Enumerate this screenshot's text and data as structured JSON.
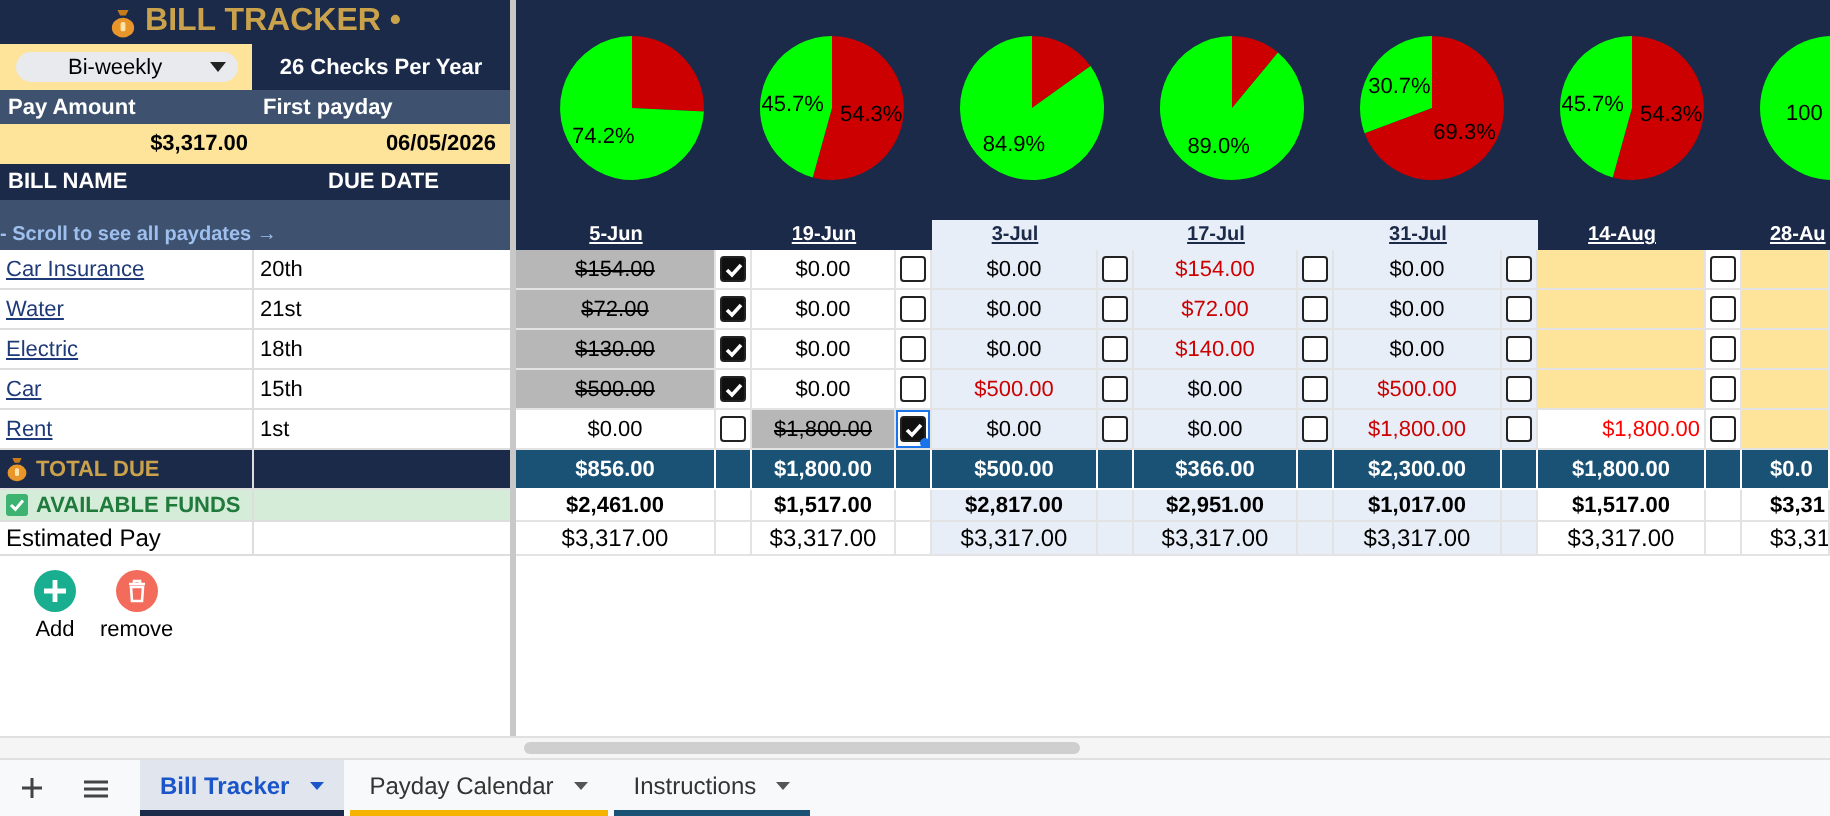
{
  "header": {
    "title": "BILL TRACKER •",
    "frequency": "Bi-weekly",
    "checks_per_year": "26 Checks Per Year",
    "pay_amount_label": "Pay Amount",
    "first_payday_label": "First payday",
    "pay_amount": "$3,317.00",
    "first_payday": "06/05/2026"
  },
  "bills_header": {
    "name": "BILL NAME",
    "due": "DUE DATE",
    "scroll_hint": "- Scroll to see all paydates →"
  },
  "bills": [
    {
      "name": "Car Insurance",
      "due": "20th"
    },
    {
      "name": "Water",
      "due": "21st"
    },
    {
      "name": "Electric",
      "due": "18th"
    },
    {
      "name": "Car",
      "due": "15th"
    },
    {
      "name": "Rent",
      "due": "1st"
    }
  ],
  "summary": {
    "total_due": "TOTAL DUE",
    "available_funds": "AVAILABLE FUNDS",
    "estimated_pay": "Estimated Pay"
  },
  "actions": [
    {
      "kind": "add",
      "label": "Add"
    },
    {
      "kind": "remove",
      "label": "remove"
    }
  ],
  "pies": [
    {
      "chart_data": {
        "type": "pie",
        "values": [
          25.8,
          74.2
        ],
        "value_labels": [
          null,
          "74.2%"
        ]
      }
    },
    {
      "chart_data": {
        "type": "pie",
        "values": [
          54.3,
          45.7
        ],
        "value_labels": [
          "54.3%",
          "45.7%"
        ]
      }
    },
    {
      "chart_data": {
        "type": "pie",
        "values": [
          15.1,
          84.9
        ],
        "value_labels": [
          null,
          "84.9%"
        ]
      }
    },
    {
      "chart_data": {
        "type": "pie",
        "values": [
          11.0,
          89.0
        ],
        "value_labels": [
          null,
          "89.0%"
        ]
      }
    },
    {
      "chart_data": {
        "type": "pie",
        "values": [
          69.3,
          30.7
        ],
        "value_labels": [
          "69.3%",
          "30.7%"
        ]
      }
    },
    {
      "chart_data": {
        "type": "pie",
        "values": [
          54.3,
          45.7
        ],
        "value_labels": [
          "54.3%",
          "45.7%"
        ]
      }
    },
    {
      "chart_data": {
        "type": "pie",
        "values": [
          0,
          100
        ],
        "value_labels": [
          null,
          "100"
        ]
      }
    }
  ],
  "periods": [
    {
      "date": "5-Jun",
      "highlighted": false,
      "total": "$856.00",
      "funds": "$2,461.00",
      "estimated": "$3,317.00",
      "cells": [
        {
          "amount": "$154.00",
          "kind": "paid",
          "checked": true,
          "selected": false
        },
        {
          "amount": "$72.00",
          "kind": "paid",
          "checked": true,
          "selected": false
        },
        {
          "amount": "$130.00",
          "kind": "paid",
          "checked": true,
          "selected": false
        },
        {
          "amount": "$500.00",
          "kind": "paid",
          "checked": true,
          "selected": false
        },
        {
          "amount": "$0.00",
          "kind": "none",
          "checked": false,
          "selected": false
        }
      ]
    },
    {
      "date": "19-Jun",
      "highlighted": false,
      "total": "$1,800.00",
      "funds": "$1,517.00",
      "estimated": "$3,317.00",
      "cells": [
        {
          "amount": "$0.00",
          "kind": "none",
          "checked": false,
          "selected": false
        },
        {
          "amount": "$0.00",
          "kind": "none",
          "checked": false,
          "selected": false
        },
        {
          "amount": "$0.00",
          "kind": "none",
          "checked": false,
          "selected": false
        },
        {
          "amount": "$0.00",
          "kind": "none",
          "checked": false,
          "selected": false
        },
        {
          "amount": "$1,800.00",
          "kind": "paid",
          "checked": true,
          "selected": true
        }
      ]
    },
    {
      "date": "3-Jul",
      "highlighted": true,
      "total": "$500.00",
      "funds": "$2,817.00",
      "estimated": "$3,317.00",
      "cells": [
        {
          "amount": "$0.00",
          "kind": "none",
          "checked": false,
          "selected": false
        },
        {
          "amount": "$0.00",
          "kind": "none",
          "checked": false,
          "selected": false
        },
        {
          "amount": "$0.00",
          "kind": "none",
          "checked": false,
          "selected": false
        },
        {
          "amount": "$500.00",
          "kind": "due",
          "checked": false,
          "selected": false
        },
        {
          "amount": "$0.00",
          "kind": "none",
          "checked": false,
          "selected": false
        }
      ]
    },
    {
      "date": "17-Jul",
      "highlighted": true,
      "total": "$366.00",
      "funds": "$2,951.00",
      "estimated": "$3,317.00",
      "cells": [
        {
          "amount": "$154.00",
          "kind": "due",
          "checked": false,
          "selected": false
        },
        {
          "amount": "$72.00",
          "kind": "due",
          "checked": false,
          "selected": false
        },
        {
          "amount": "$140.00",
          "kind": "due",
          "checked": false,
          "selected": false
        },
        {
          "amount": "$0.00",
          "kind": "none",
          "checked": false,
          "selected": false
        },
        {
          "amount": "$0.00",
          "kind": "none",
          "checked": false,
          "selected": false
        }
      ]
    },
    {
      "date": "31-Jul",
      "highlighted": true,
      "total": "$2,300.00",
      "funds": "$1,017.00",
      "estimated": "$3,317.00",
      "cells": [
        {
          "amount": "$0.00",
          "kind": "none",
          "checked": false,
          "selected": false
        },
        {
          "amount": "$0.00",
          "kind": "none",
          "checked": false,
          "selected": false
        },
        {
          "amount": "$0.00",
          "kind": "none",
          "checked": false,
          "selected": false
        },
        {
          "amount": "$500.00",
          "kind": "due",
          "checked": false,
          "selected": false
        },
        {
          "amount": "$1,800.00",
          "kind": "due",
          "checked": false,
          "selected": false
        }
      ]
    },
    {
      "date": "14-Aug",
      "highlighted": false,
      "total": "$1,800.00",
      "funds": "$1,517.00",
      "estimated": "$3,317.00",
      "cells": [
        {
          "kind": "blank",
          "checked": false,
          "selected": false
        },
        {
          "kind": "blank",
          "checked": false,
          "selected": false
        },
        {
          "kind": "blank",
          "checked": false,
          "selected": false
        },
        {
          "kind": "blank",
          "checked": false,
          "selected": false
        },
        {
          "amount": "$1,800.00",
          "kind": "upcoming",
          "checked": false,
          "selected": false
        }
      ]
    },
    {
      "date": "28-Au",
      "highlighted": false,
      "total": "$0.0",
      "funds": "$3,31",
      "estimated": "$3,31",
      "cells": [
        {
          "kind": "blank",
          "selected": false
        },
        {
          "kind": "blank",
          "selected": false
        },
        {
          "kind": "blank",
          "selected": false
        },
        {
          "kind": "blank",
          "selected": false
        },
        {
          "kind": "blank",
          "selected": false
        }
      ]
    }
  ],
  "sheet_tabs": [
    {
      "label": "Bill Tracker",
      "selected": true,
      "color": "#1c2a4a"
    },
    {
      "label": "Payday Calendar",
      "selected": false,
      "color": "#f4b400"
    },
    {
      "label": "Instructions",
      "selected": false,
      "color": "#1a5276"
    }
  ]
}
